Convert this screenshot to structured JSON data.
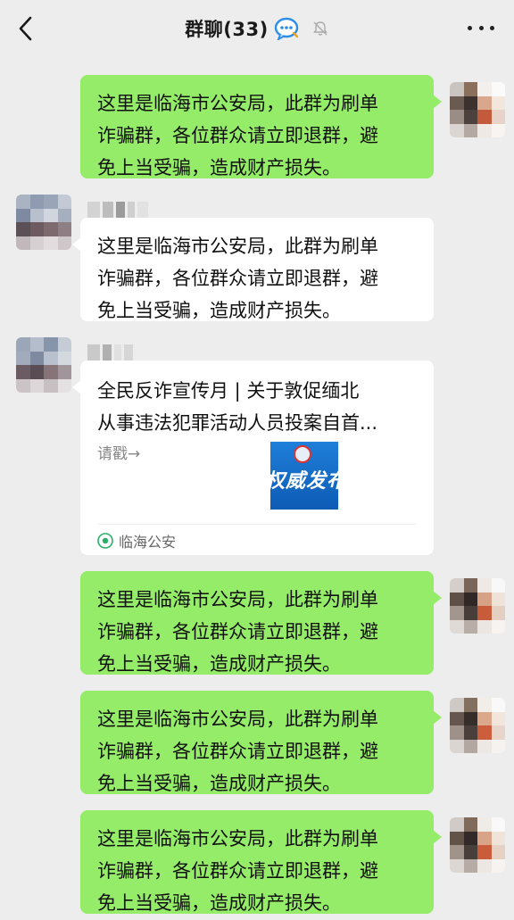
{
  "header": {
    "title": "群聊(33)",
    "back_icon": "chevron-left-icon",
    "group_icon": "group-chat-icon",
    "mute_icon": "bell-muted-icon",
    "more_icon": "more-dots-icon"
  },
  "colors": {
    "background": "#ededed",
    "bubble_self": "#95ec69",
    "bubble_other": "#ffffff"
  },
  "messages": [
    {
      "side": "right",
      "lines": [
        "这里是临海市公安局，此群为刷单",
        "诈骗群，各位群众请立即退群，避",
        "免上当受骗，造成财产损失。"
      ]
    },
    {
      "side": "left",
      "lines": [
        "这里是临海市公安局，此群为刷单",
        "诈骗群，各位群众请立即退群，避",
        "免上当受骗，造成财产损失。"
      ]
    },
    {
      "side": "right",
      "lines": [
        "这里是临海市公安局，此群为刷单",
        "诈骗群，各位群众请立即退群，避",
        "免上当受骗，造成财产损失。"
      ]
    },
    {
      "side": "right",
      "lines": [
        "这里是临海市公安局，此群为刷单",
        "诈骗群，各位群众请立即退群，避",
        "免上当受骗，造成财产损失。"
      ]
    },
    {
      "side": "right",
      "lines": [
        "这里是临海市公安局，此群为刷单",
        "诈骗群，各位群众请立即退群，避",
        "免上当受骗，造成财产损失。"
      ]
    }
  ],
  "link_card": {
    "title_line1": "全民反诈宣传月 | 关于敦促缅北",
    "title_line2": "从事违法犯罪活动人员投案自首...",
    "description": "请戳→",
    "thumbnail_text": "权威发布",
    "source": "临海公安",
    "source_icon": "official-account-icon"
  }
}
